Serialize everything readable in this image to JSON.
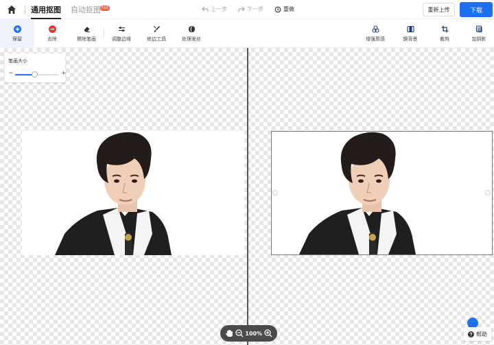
{
  "header": {
    "tabs": [
      {
        "label": "通用抠图",
        "active": true
      },
      {
        "label": "自动抠图",
        "active": false,
        "badge": "hot"
      }
    ],
    "undo_label": "上一步",
    "redo_label": "下一步",
    "reset_label": "重做",
    "reupload_label": "重新上传",
    "download_label": "下载"
  },
  "toolbar": {
    "left_tools": [
      {
        "label": "保留",
        "icon": "plus-circle-icon",
        "active": true
      },
      {
        "label": "去除",
        "icon": "minus-circle-icon",
        "active": false
      },
      {
        "label": "擦除笔画",
        "icon": "eraser-icon",
        "active": false
      },
      {
        "label": "调整边缘",
        "icon": "sliders-icon",
        "active": false
      },
      {
        "label": "修边工具",
        "icon": "brush-icon",
        "active": false
      },
      {
        "label": "处理发丝",
        "icon": "hair-icon",
        "active": false
      }
    ],
    "right_tools": [
      {
        "label": "增强质感",
        "icon": "enhance-icon"
      },
      {
        "label": "换背景",
        "icon": "background-icon"
      },
      {
        "label": "裁剪",
        "icon": "crop-icon"
      },
      {
        "label": "加阴影",
        "icon": "shadow-icon"
      }
    ]
  },
  "brush": {
    "title": "笔画大小",
    "minus": "−",
    "plus": "+",
    "value_fraction": 0.45
  },
  "zoom": {
    "level": "100%"
  },
  "help": {
    "label": "帮助"
  },
  "colors": {
    "accent": "#1f6ff5",
    "remove": "#e53935",
    "hot_badge": "#ff5a3c"
  }
}
